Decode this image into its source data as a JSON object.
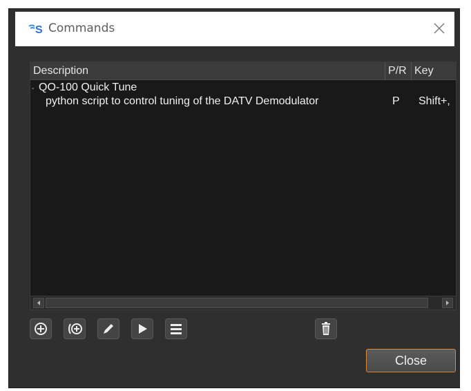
{
  "window": {
    "title": "Commands"
  },
  "table": {
    "columns": [
      "Description",
      "P/R",
      "Key"
    ],
    "group": {
      "expander": "-",
      "label": "QO-100 Quick Tune"
    },
    "rows": [
      {
        "description": "python script to control tuning of the DATV Demodulator",
        "pr": "P",
        "key": "Shift+,"
      }
    ]
  },
  "toolbar": {
    "buttons": [
      "add-icon",
      "add-group-icon",
      "edit-icon",
      "run-icon",
      "list-icon",
      "delete-icon"
    ]
  },
  "footer": {
    "close_label": "Close"
  }
}
